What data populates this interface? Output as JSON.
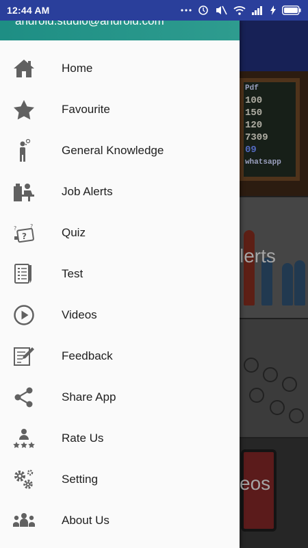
{
  "status_bar": {
    "time": "12:44 AM",
    "icons": [
      "more-dots-icon",
      "alarm-icon",
      "mute-icon",
      "wifi-icon",
      "signal-icon",
      "charging-icon",
      "battery-icon"
    ]
  },
  "drawer": {
    "header": {
      "email": "android.studio@android.com"
    },
    "items": [
      {
        "label": "Home",
        "icon": "home-icon"
      },
      {
        "label": "Favourite",
        "icon": "star-icon"
      },
      {
        "label": "General Knowledge",
        "icon": "thinking-person-icon"
      },
      {
        "label": "Job Alerts",
        "icon": "desk-worker-icon"
      },
      {
        "label": "Quiz",
        "icon": "quiz-icon"
      },
      {
        "label": "Test",
        "icon": "test-sheet-icon"
      },
      {
        "label": "Videos",
        "icon": "play-circle-icon"
      },
      {
        "label": "Feedback",
        "icon": "feedback-icon"
      },
      {
        "label": "Share App",
        "icon": "share-icon"
      },
      {
        "label": "Rate Us",
        "icon": "rate-us-icon"
      },
      {
        "label": "Setting",
        "icon": "gears-icon"
      },
      {
        "label": "About Us",
        "icon": "group-icon"
      }
    ]
  },
  "background": {
    "card1_lines": [
      "Pdf",
      "100",
      "150",
      "120",
      "7309",
      "09",
      "whatsapp"
    ],
    "card2_text": "lerts",
    "card4_text": "eos"
  },
  "colors": {
    "status_bar": "#2a3f9b",
    "drawer_header": "#1e8e84",
    "icon_gray": "#616161"
  }
}
